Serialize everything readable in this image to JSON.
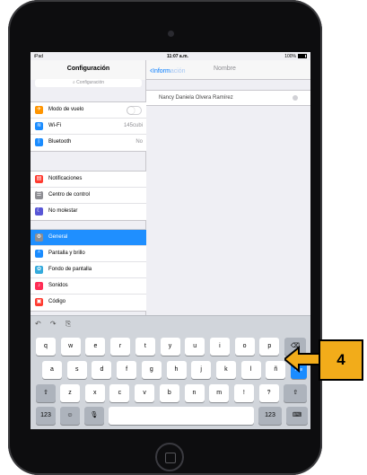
{
  "status_bar": {
    "carrier": "iPad",
    "time": "11:07 a.m.",
    "battery": "100%"
  },
  "master": {
    "title": "Configuración",
    "search_placeholder": "Configuración",
    "groups": [
      [
        {
          "label": "Modo de vuelo",
          "icon": "airplane-icon",
          "color": "#ff9500",
          "glyph": "✈",
          "toggle": true
        },
        {
          "label": "Wi-Fi",
          "icon": "wifi-icon",
          "color": "#1a8cff",
          "glyph": "≋",
          "value": "145cubi"
        },
        {
          "label": "Bluetooth",
          "icon": "bluetooth-icon",
          "color": "#1a8cff",
          "glyph": "ᛒ",
          "value": "No"
        }
      ],
      [
        {
          "label": "Notificaciones",
          "icon": "notifications-icon",
          "color": "#ff3b30",
          "glyph": "▤"
        },
        {
          "label": "Centro de control",
          "icon": "control-center-icon",
          "color": "#8e8e93",
          "glyph": "☰"
        },
        {
          "label": "No molestar",
          "icon": "moon-icon",
          "color": "#5856d6",
          "glyph": "☾"
        }
      ],
      [
        {
          "label": "General",
          "icon": "gear-icon",
          "color": "#8e8e93",
          "glyph": "⚙",
          "selected": true
        },
        {
          "label": "Pantalla y brillo",
          "icon": "display-icon",
          "color": "#1a8cff",
          "glyph": "ᴬ"
        },
        {
          "label": "Fondo de pantalla",
          "icon": "wallpaper-icon",
          "color": "#34aadc",
          "glyph": "✿"
        },
        {
          "label": "Sonidos",
          "icon": "sound-icon",
          "color": "#ff2d55",
          "glyph": "♪"
        },
        {
          "label": "Código",
          "icon": "lock-icon",
          "color": "#ff3b30",
          "glyph": "▣"
        }
      ]
    ]
  },
  "detail": {
    "back_label_start": "Inform",
    "back_label_end": "ación",
    "title": "Nombre",
    "name_value_start": "Nancy Dan",
    "name_value_end": "iela Olvera Ramírez"
  },
  "keyboard": {
    "shortcut_icons": [
      "undo-icon",
      "redo-icon",
      "paste-icon"
    ],
    "shortcuts": "↶ ↷ ⎘",
    "rows": [
      [
        "q",
        "w",
        "e",
        "r",
        "t",
        "y",
        "u",
        "i",
        "o",
        "p"
      ],
      [
        "a",
        "s",
        "d",
        "f",
        "g",
        "h",
        "j",
        "k",
        "l",
        "ñ"
      ],
      [
        "z",
        "x",
        "c",
        "v",
        "b",
        "n",
        "m",
        "!",
        "?"
      ]
    ],
    "row3_subs": [
      "",
      "",
      "",
      "",
      "",
      "",
      "",
      ",",
      "."
    ],
    "delete_glyph": "⌫",
    "return_label": "Ace",
    "shift_glyph": "⇧",
    "numbers_label": "123",
    "emoji_glyph": "☺",
    "mic_glyph": "🎙",
    "hide_glyph": "⌨"
  },
  "annotation": {
    "step": "4",
    "color": "#f2ac1a"
  }
}
